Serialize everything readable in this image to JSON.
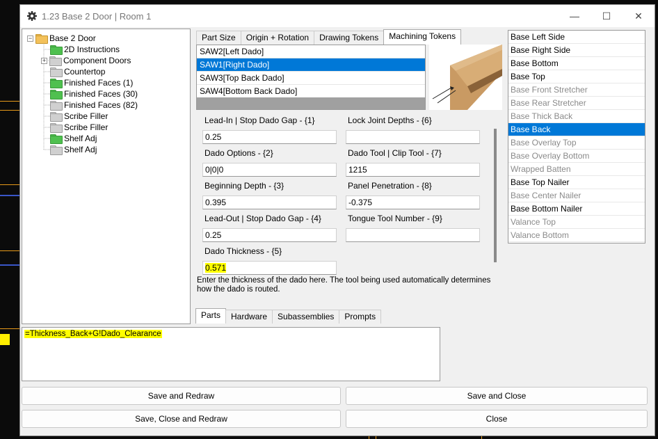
{
  "window": {
    "title": "1.23 Base 2 Door | Room 1",
    "controls": [
      "—",
      "☐",
      "✕"
    ]
  },
  "tree": {
    "root": "Base 2 Door",
    "items": [
      {
        "label": "2D Instructions",
        "folder": "green",
        "expandable": false
      },
      {
        "label": "Component Doors",
        "folder": "gray",
        "expandable": true
      },
      {
        "label": "Countertop",
        "folder": "gray",
        "expandable": false
      },
      {
        "label": "Finished Faces (1)",
        "folder": "green",
        "expandable": false
      },
      {
        "label": "Finished Faces (30)",
        "folder": "green",
        "expandable": false
      },
      {
        "label": "Finished Faces (82)",
        "folder": "gray",
        "expandable": false
      },
      {
        "label": "Scribe Filler",
        "folder": "gray",
        "expandable": false
      },
      {
        "label": "Scribe Filler",
        "folder": "gray",
        "expandable": false
      },
      {
        "label": "Shelf Adj",
        "folder": "green",
        "expandable": false
      },
      {
        "label": "Shelf Adj",
        "folder": "gray",
        "expandable": false
      }
    ]
  },
  "top_tabs": [
    "Part Size",
    "Origin + Rotation",
    "Drawing Tokens",
    "Machining Tokens"
  ],
  "top_tab_active": "Machining Tokens",
  "tokens": [
    {
      "label": "SAW2[Left Dado]",
      "selected": false
    },
    {
      "label": "SAW1[Right Dado]",
      "selected": true
    },
    {
      "label": "SAW3[Top Back Dado]",
      "selected": false
    },
    {
      "label": "SAW4[Bottom Back Dado]",
      "selected": false
    }
  ],
  "params": {
    "p1": {
      "label": "Lead-In | Stop Dado Gap - {1}",
      "value": "0.25"
    },
    "p2": {
      "label": "Dado Options - {2}",
      "value": "0|0|0"
    },
    "p3": {
      "label": "Beginning Depth - {3}",
      "value": "0.395"
    },
    "p4": {
      "label": "Lead-Out | Stop Dado Gap - {4}",
      "value": "0.25"
    },
    "p5": {
      "label": "Dado Thickness - {5}",
      "value": "0.571"
    },
    "p6": {
      "label": "Lock Joint Depths - {6}",
      "value": ""
    },
    "p7": {
      "label": "Dado Tool | Clip Tool - {7}",
      "value": "1215"
    },
    "p8": {
      "label": "Panel Penetration - {8}",
      "value": "-0.375"
    },
    "p9": {
      "label": "Tongue Tool Number - {9}",
      "value": ""
    }
  },
  "description": "Enter the thickness of the dado here. The tool being used automatically determines how the dado is routed.",
  "bottom_tabs": [
    "Parts",
    "Hardware",
    "Subassemblies",
    "Prompts"
  ],
  "bottom_tab_active": "Parts",
  "parts": [
    {
      "label": "Base Left Side",
      "state": "normal"
    },
    {
      "label": "Base Right Side",
      "state": "normal"
    },
    {
      "label": "Base Bottom",
      "state": "normal"
    },
    {
      "label": "Base Top",
      "state": "normal"
    },
    {
      "label": "Base Front Stretcher",
      "state": "dim"
    },
    {
      "label": "Base Rear Stretcher",
      "state": "dim"
    },
    {
      "label": "Base Thick Back",
      "state": "dim"
    },
    {
      "label": "Base Back",
      "state": "selected"
    },
    {
      "label": "Base Overlay Top",
      "state": "dim"
    },
    {
      "label": "Base Overlay Bottom",
      "state": "dim"
    },
    {
      "label": "Wrapped Batten",
      "state": "dim"
    },
    {
      "label": "Base Top Nailer",
      "state": "normal"
    },
    {
      "label": "Base Center Nailer",
      "state": "dim"
    },
    {
      "label": "Base Bottom Nailer",
      "state": "normal"
    },
    {
      "label": "Valance Top",
      "state": "dim"
    },
    {
      "label": "Valance Bottom",
      "state": "dim"
    }
  ],
  "formula": "=Thickness_Back+G!Dado_Clearance",
  "buttons": {
    "save_redraw": "Save and Redraw",
    "save_close": "Save and Close",
    "save_close_redraw": "Save, Close and Redraw",
    "close": "Close"
  },
  "colors": {
    "selection": "#0078d7",
    "highlight": "#ffff00"
  }
}
